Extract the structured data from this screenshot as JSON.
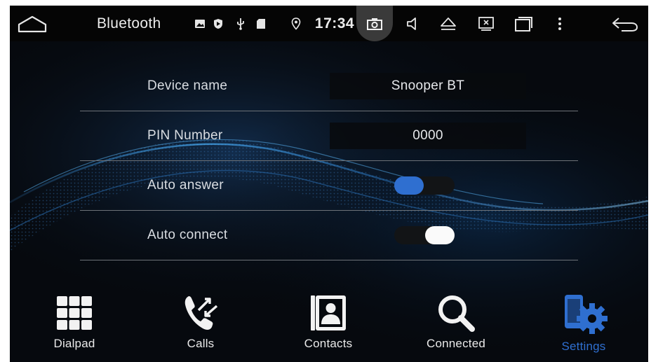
{
  "statusbar": {
    "title": "Bluetooth",
    "time": "17:34",
    "icons": [
      "home-icon",
      "image-icon",
      "shield-icon",
      "usb-icon",
      "sd-card-icon",
      "location-icon",
      "camera-icon",
      "volume-icon",
      "eject-icon",
      "close-window-icon",
      "recent-apps-icon",
      "more-icon",
      "back-icon"
    ]
  },
  "settings": {
    "device_name_label": "Device name",
    "device_name_value": "Snooper BT",
    "pin_label": "PIN Number",
    "pin_value": "0000",
    "auto_answer_label": "Auto answer",
    "auto_answer_enabled": true,
    "auto_connect_label": "Auto connect",
    "auto_connect_enabled": false
  },
  "nav": {
    "dialpad": "Dialpad",
    "calls": "Calls",
    "contacts": "Contacts",
    "connected": "Connected",
    "settings": "Settings",
    "active": "settings"
  },
  "colors": {
    "accent": "#2f6fd0",
    "background": "#06090e",
    "statusbar": "#050505"
  }
}
